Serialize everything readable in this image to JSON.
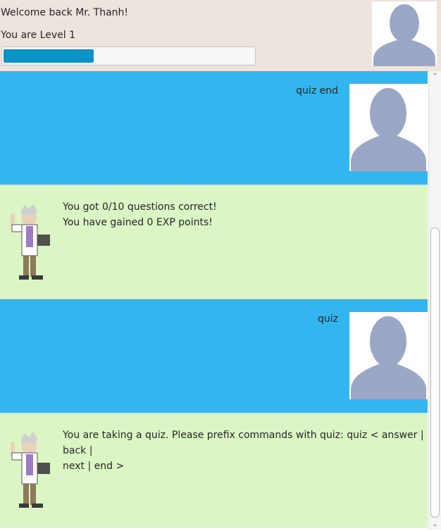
{
  "header": {
    "welcome_text": "Welcome back Mr. Thanh!",
    "level_text": "You are Level 1",
    "exp_progress_fraction": 0.36
  },
  "chat": {
    "messages": [
      {
        "sender": "user",
        "lines": [
          "quiz end"
        ]
      },
      {
        "sender": "bot",
        "lines": [
          "You got 0/10 questions correct!",
          "You have gained 0 EXP points!"
        ]
      },
      {
        "sender": "user",
        "lines": [
          "quiz"
        ]
      },
      {
        "sender": "bot",
        "lines": [
          "You are taking a quiz. Please prefix commands with quiz: quiz   < answer | back |",
          "next | end >"
        ]
      }
    ]
  },
  "icons": {
    "user_avatar": "user-silhouette-icon",
    "bot_avatar": "professor-sprite-icon"
  },
  "colors": {
    "header_bg": "#ece4dd",
    "user_bubble": "#33b5ef",
    "bot_bubble": "#dcf5c5",
    "progress_fill": "#0b93c5",
    "avatar_silhouette": "#9aa7c6"
  }
}
